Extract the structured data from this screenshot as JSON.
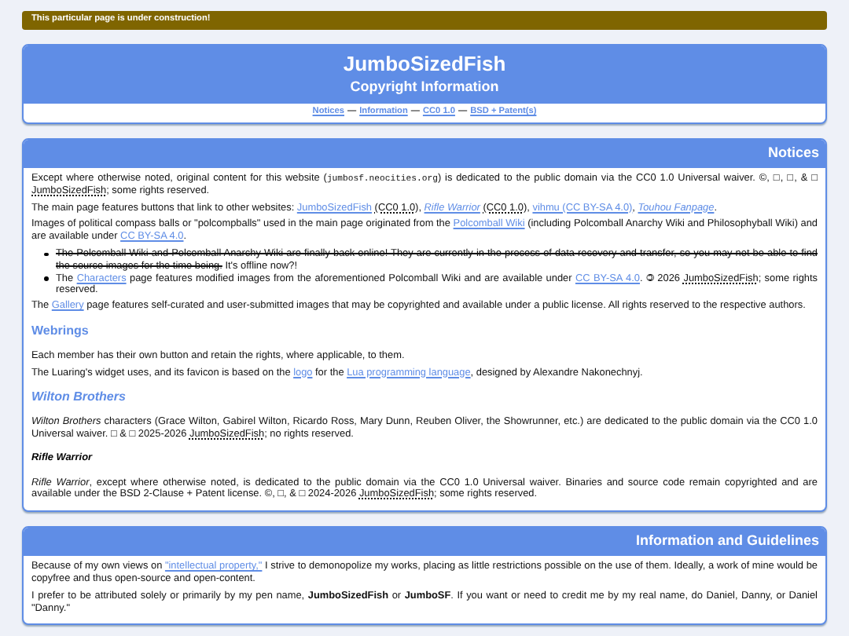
{
  "banner": {
    "text": "This particular page is under construction!"
  },
  "header": {
    "title": "JumboSizedFish",
    "subtitle": "Copyright Information",
    "nav": {
      "separator": "—",
      "links": [
        "Notices",
        "Information",
        "CC0 1.0",
        "BSD + Patent(s)"
      ]
    }
  },
  "sections": [
    {
      "title": "Notices",
      "blocks": [
        {
          "kind": "paragraph",
          "segments": [
            {
              "kind": "text",
              "text": "Except where otherwise noted, original content for this website ("
            },
            {
              "kind": "code",
              "text": "jumbosf.neocities.org"
            },
            {
              "kind": "text",
              "text": ") is dedicated to the public domain via the CC0 1.0 Universal waiver. ©, □, □, & □ "
            },
            {
              "kind": "abbr",
              "text": "JumboSizedFish"
            },
            {
              "kind": "text",
              "text": "; some rights reserved."
            }
          ]
        },
        {
          "kind": "paragraph",
          "segments": [
            {
              "kind": "text",
              "text": "The main page features buttons that link to other websites: "
            },
            {
              "kind": "link",
              "text": "JumboSizedFish"
            },
            {
              "kind": "abbr",
              "text": " (CC0 1.0)",
              "tail": ", "
            },
            {
              "kind": "italic_link",
              "text": "Rifle Warrior"
            },
            {
              "kind": "abbr",
              "text": " (CC0 1.0)",
              "tail": ", "
            },
            {
              "kind": "link",
              "text": "vihmu (CC BY-SA 4.0)",
              "tail": ", "
            },
            {
              "kind": "italic_link",
              "text": "Touhou Fanpage",
              "tail": "."
            }
          ]
        },
        {
          "kind": "paragraph",
          "segments": [
            {
              "kind": "text",
              "text": "Images of political compass balls or \"polcompballs\" used in the main page originated from the "
            },
            {
              "kind": "link",
              "text": "Polcomball Wiki"
            },
            {
              "kind": "text",
              "text": " (including Polcomball Anarchy Wiki and Philosophyball Wiki) and are available under "
            },
            {
              "kind": "link",
              "text": "CC BY-SA 4.0"
            },
            {
              "kind": "text",
              "text": "."
            }
          ]
        },
        {
          "kind": "bullets",
          "items": [
            [
              {
                "kind": "strike",
                "text": "The Polcomball Wiki and Polcomball Anarchy Wiki are finally back online! They are currently in the process of data recovery and transfer, so you may not be able to find the source images for the time being."
              },
              {
                "kind": "text",
                "text": " It's offline now?!"
              }
            ],
            [
              {
                "kind": "text",
                "text": "The "
              },
              {
                "kind": "link",
                "text": "Characters"
              },
              {
                "kind": "text",
                "text": " page features modified images from the aforementioned Polcomball Wiki and are available under "
              },
              {
                "kind": "link",
                "text": "CC BY-SA 4.0"
              },
              {
                "kind": "text",
                "text": ". 🄯 2026 "
              },
              {
                "kind": "abbr",
                "text": "JumboSizedFish"
              },
              {
                "kind": "text",
                "text": "; some rights reserved."
              }
            ]
          ]
        },
        {
          "kind": "paragraph",
          "segments": [
            {
              "kind": "text",
              "text": "The "
            },
            {
              "kind": "link",
              "text": "Gallery"
            },
            {
              "kind": "text",
              "text": " page features self-curated and user-submitted images that may be copyrighted and available under a public license. All rights reserved to the respective authors."
            }
          ]
        },
        {
          "kind": "heading",
          "text": "Webrings"
        },
        {
          "kind": "paragraph",
          "segments": [
            {
              "kind": "text",
              "text": "Each member has their own button and retain the rights, where applicable, to them."
            }
          ]
        },
        {
          "kind": "paragraph",
          "segments": [
            {
              "kind": "text",
              "text": "The Luaring's widget uses, and its favicon is based on the "
            },
            {
              "kind": "link",
              "text": "logo"
            },
            {
              "kind": "text",
              "text": " for the "
            },
            {
              "kind": "link",
              "text": "Lua programming language"
            },
            {
              "kind": "text",
              "text": ", designed by Alexandre Nakonechnyj."
            }
          ]
        },
        {
          "kind": "italic_heading",
          "text": "Wilton Brothers"
        },
        {
          "kind": "paragraph",
          "segments": [
            {
              "kind": "italic",
              "text": "Wilton Brothers"
            },
            {
              "kind": "text",
              "text": " characters (Grace Wilton, Gabirel Wilton, Ricardo Ross, Mary Dunn, Reuben Oliver, the Showrunner, etc.) are dedicated to the public domain via the CC0 1.0 Universal waiver. □ & □ 2025-2026 "
            },
            {
              "kind": "abbr",
              "text": "JumboSizedFish"
            },
            {
              "kind": "text",
              "text": "; no rights reserved."
            }
          ]
        },
        {
          "kind": "subheading",
          "text": "Rifle Warrior"
        },
        {
          "kind": "paragraph",
          "segments": [
            {
              "kind": "italic",
              "text": "Rifle Warrior"
            },
            {
              "kind": "text",
              "text": ", except where otherwise noted, is dedicated to the public domain via the CC0 1.0 Universal waiver. Binaries and source code remain copyrighted and are available under the BSD 2-Clause + Patent license. ©, □, & □ 2024-2026 "
            },
            {
              "kind": "abbr",
              "text": "JumboSizedFish"
            },
            {
              "kind": "text",
              "text": "; some rights reserved."
            }
          ]
        }
      ]
    },
    {
      "title": "Information and Guidelines",
      "blocks": [
        {
          "kind": "paragraph",
          "segments": [
            {
              "kind": "text",
              "text": "Because of my own views on "
            },
            {
              "kind": "link",
              "text": "\"intellectual property,\""
            },
            {
              "kind": "text",
              "text": " I strive to demonopolize my works, placing as little restrictions possible on the use of them. Ideally, a work of mine would be copyfree and thus open-source and open-content."
            }
          ]
        },
        {
          "kind": "paragraph",
          "segments": [
            {
              "kind": "text",
              "text": "I prefer to be attributed solely or primarily by my pen name, "
            },
            {
              "kind": "bold",
              "text": "JumboSizedFish"
            },
            {
              "kind": "text",
              "text": " or "
            },
            {
              "kind": "bold",
              "text": "JumboSF"
            },
            {
              "kind": "text",
              "text": ". If you want or need to credit me by my real name, do Daniel, Danny, or Daniel \"Danny.\""
            }
          ]
        }
      ]
    }
  ]
}
